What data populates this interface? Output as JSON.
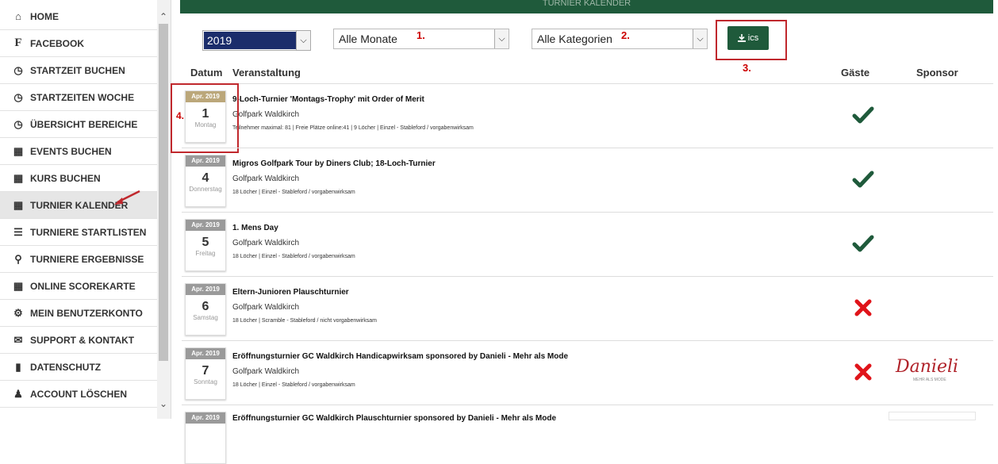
{
  "sidebar": {
    "items": [
      {
        "label": "HOME",
        "icon": "home-icon"
      },
      {
        "label": "FACEBOOK",
        "icon": "facebook-icon"
      },
      {
        "label": "STARTZEIT BUCHEN",
        "icon": "clock-icon"
      },
      {
        "label": "STARTZEITEN WOCHE",
        "icon": "clock-icon"
      },
      {
        "label": "ÜBERSICHT BEREICHE",
        "icon": "clock-icon"
      },
      {
        "label": "EVENTS BUCHEN",
        "icon": "calendar-icon"
      },
      {
        "label": "KURS BUCHEN",
        "icon": "calendar-icon"
      },
      {
        "label": "TURNIER KALENDER",
        "icon": "calendar-icon"
      },
      {
        "label": "TURNIERE STARTLISTEN",
        "icon": "list-icon"
      },
      {
        "label": "TURNIERE ERGEBNISSE",
        "icon": "trophy-icon"
      },
      {
        "label": "ONLINE SCOREKARTE",
        "icon": "table-icon"
      },
      {
        "label": "MEIN BENUTZERKONTO",
        "icon": "gears-icon"
      },
      {
        "label": "SUPPORT & KONTAKT",
        "icon": "envelope-icon"
      },
      {
        "label": "DATENSCHUTZ",
        "icon": "book-icon"
      },
      {
        "label": "ACCOUNT LÖSCHEN",
        "icon": "user-icon"
      }
    ]
  },
  "topbar": {
    "title": "TURNIER KALENDER"
  },
  "filters": {
    "year": "2019",
    "month": "Alle Monate",
    "category": "Alle Kategorien",
    "ics_label": "ics",
    "annotation_1": "1.",
    "annotation_2": "2.",
    "annotation_3": "3.",
    "annotation_4": "4."
  },
  "table": {
    "col_date": "Datum",
    "col_event": "Veranstaltung",
    "col_guests": "Gäste",
    "col_sponsor": "Sponsor"
  },
  "events": [
    {
      "month": "Apr. 2019",
      "day": "1",
      "weekday": "Montag",
      "title": "9-Loch-Turnier 'Montags-Trophy' mit Order of Merit",
      "place": "Golfpark Waldkirch",
      "info": "Teilnehmer maximal: 81 | Freie Plätze online:41 | 9 Löcher | Einzel - Stableford / vorgabenwirksam",
      "guests": "check"
    },
    {
      "month": "Apr. 2019",
      "day": "4",
      "weekday": "Donnerstag",
      "title": "Migros Golfpark Tour by Diners Club; 18-Loch-Turnier",
      "place": "Golfpark Waldkirch",
      "info": "18 Löcher | Einzel - Stableford / vorgabenwirksam",
      "guests": "check"
    },
    {
      "month": "Apr. 2019",
      "day": "5",
      "weekday": "Freitag",
      "title": "1. Mens Day",
      "place": "Golfpark Waldkirch",
      "info": "18 Löcher | Einzel - Stableford / vorgabenwirksam",
      "guests": "check"
    },
    {
      "month": "Apr. 2019",
      "day": "6",
      "weekday": "Samstag",
      "title": "Eltern-Junioren Plauschturnier",
      "place": "Golfpark Waldkirch",
      "info": "18 Löcher | Scramble - Stableford / nicht vorgabenwirksam",
      "guests": "cross"
    },
    {
      "month": "Apr. 2019",
      "day": "7",
      "weekday": "Sonntag",
      "title": "Eröffnungsturnier GC Waldkirch Handicapwirksam sponsored by Danieli - Mehr als Mode",
      "place": "Golfpark Waldkirch",
      "info": "18 Löcher | Einzel - Stableford / vorgabenwirksam",
      "guests": "cross",
      "sponsor": "Danieli",
      "sponsor_tag": "MEHR ALS MODE"
    },
    {
      "month": "Apr. 2019",
      "day": "",
      "weekday": "",
      "title": "Eröffnungsturnier GC Waldkirch Plauschturnier sponsored by Danieli - Mehr als Mode",
      "place": "",
      "info": "",
      "guests": ""
    }
  ],
  "colors": {
    "brand_green": "#1f5a3b",
    "annotation_red": "#c0282d",
    "cross_red": "#e0141a"
  }
}
